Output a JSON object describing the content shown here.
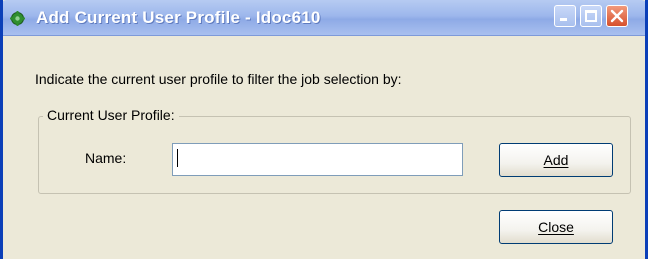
{
  "window": {
    "title": "Add Current User Profile - Idoc610",
    "icon": "green-gear-icon",
    "controls": [
      "minimize-icon",
      "maximize-icon",
      "close-icon"
    ],
    "accent_color": "#0b3fb8"
  },
  "dialog": {
    "instruction": "Indicate the current user profile to filter the job selection by:",
    "group_label": "Current User Profile:",
    "name_label": "Name:",
    "name_value": "",
    "add_label": "Add",
    "close_label": "Close"
  }
}
